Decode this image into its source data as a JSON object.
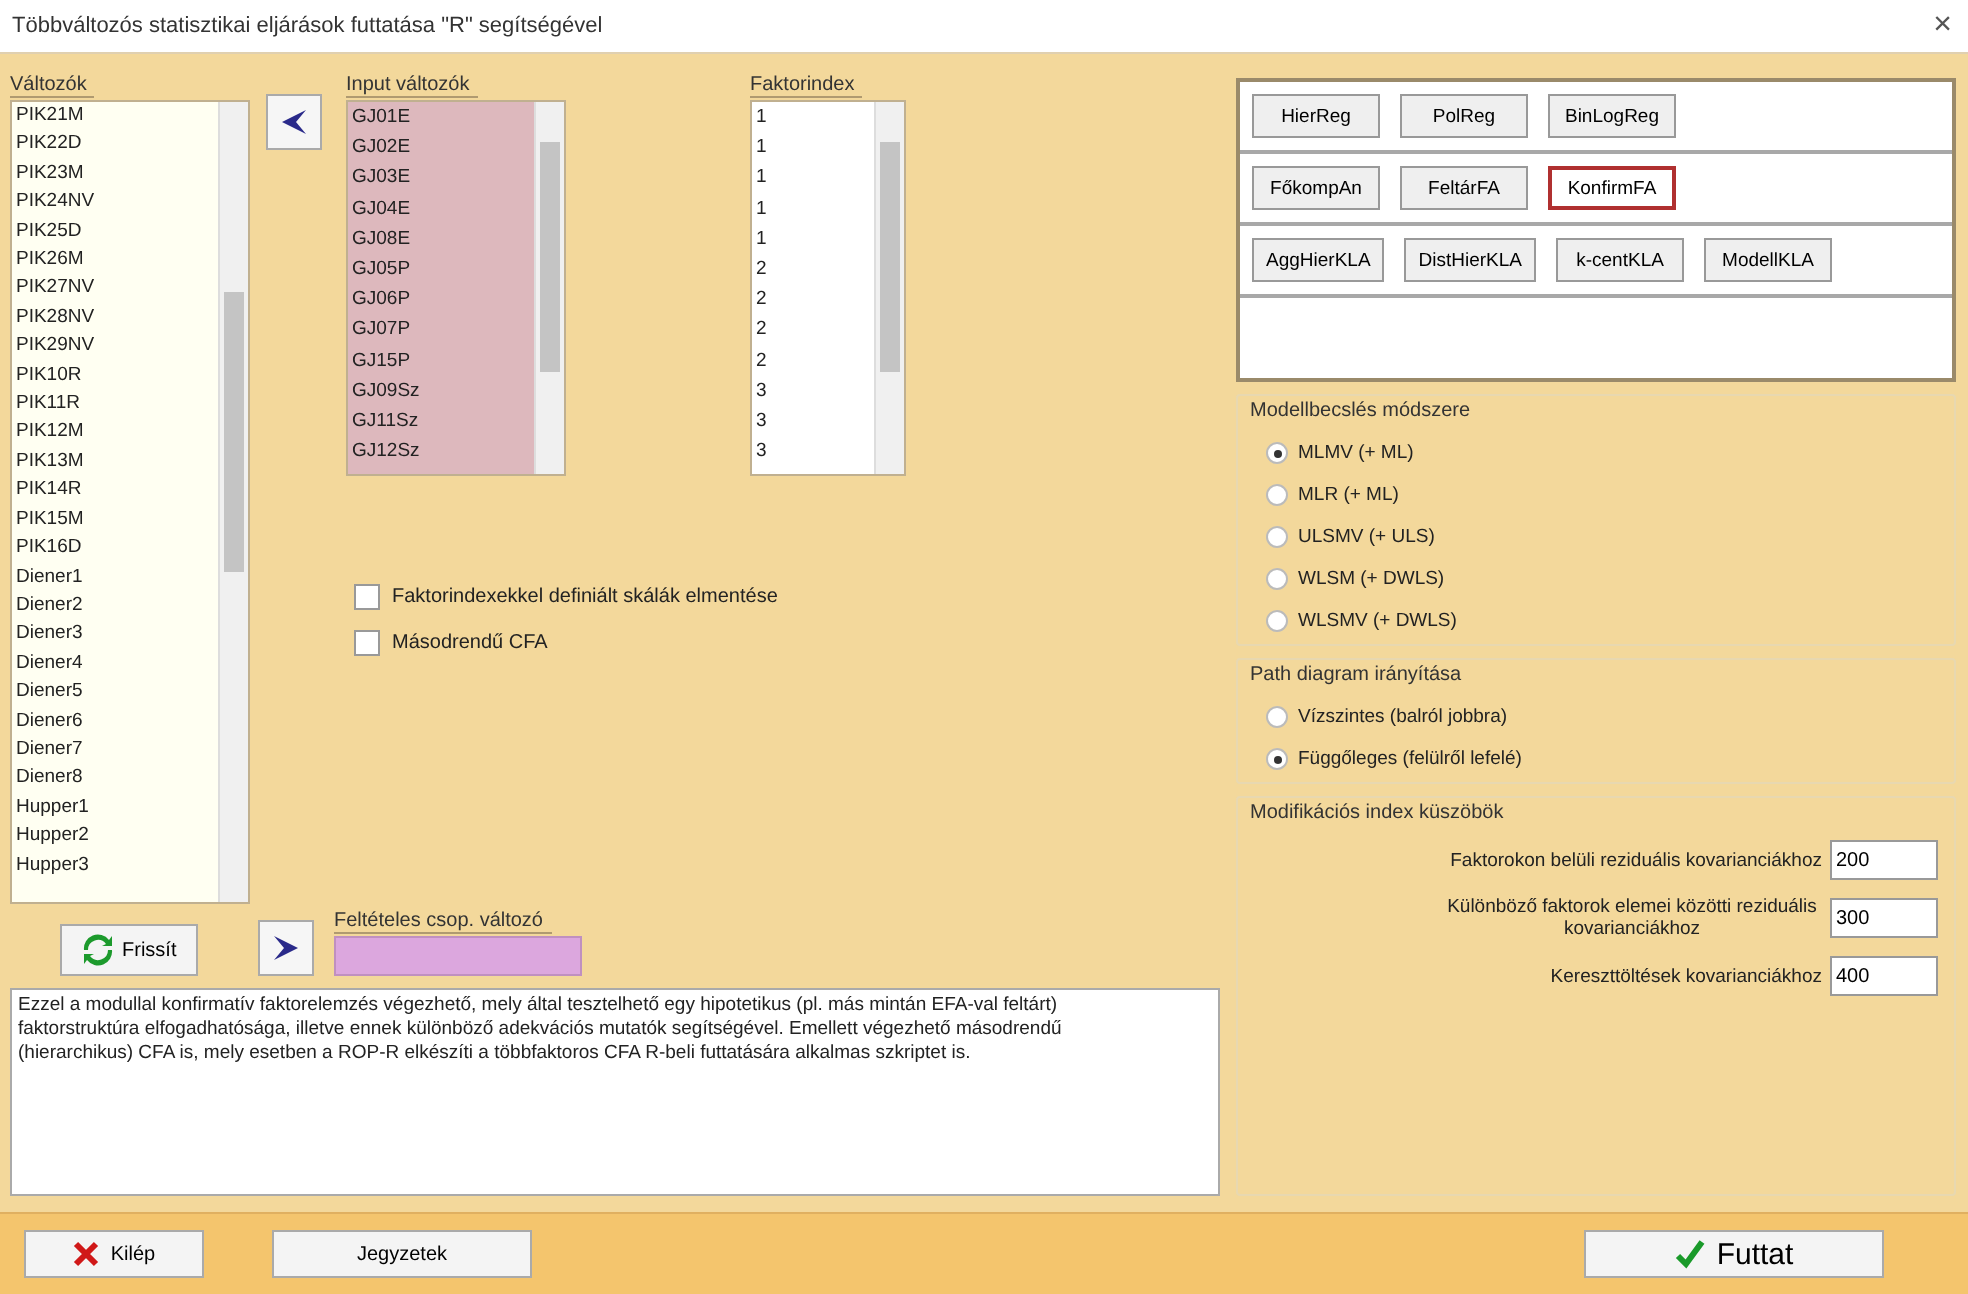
{
  "window": {
    "title": "Többváltozós statisztikai eljárások futtatása \"R\" segítségével",
    "close": "×"
  },
  "variables": {
    "label": "Változók",
    "items": [
      "PIK21M",
      "PIK22D",
      "PIK23M",
      "PIK24NV",
      "PIK25D",
      "PIK26M",
      "PIK27NV",
      "PIK28NV",
      "PIK29NV",
      "PIK10R",
      "PIK11R",
      "PIK12M",
      "PIK13M",
      "PIK14R",
      "PIK15M",
      "PIK16D",
      "Diener1",
      "Diener2",
      "Diener3",
      "Diener4",
      "Diener5",
      "Diener6",
      "Diener7",
      "Diener8",
      "Hupper1",
      "Hupper2",
      "Hupper3"
    ]
  },
  "input_variables": {
    "label": "Input változók",
    "items": [
      "GJ01E",
      "GJ02E",
      "GJ03E",
      "GJ04E",
      "GJ08E",
      "GJ05P",
      "GJ06P",
      "GJ07P",
      "GJ15P",
      "GJ09Sz",
      "GJ11Sz",
      "GJ12Sz"
    ]
  },
  "factor_index": {
    "label": "Faktorindex",
    "items": [
      "1",
      "1",
      "1",
      "1",
      "1",
      "2",
      "2",
      "2",
      "2",
      "3",
      "3",
      "3"
    ]
  },
  "checkboxes": [
    {
      "label": "Faktorindexekkel definiált skálák elmentése",
      "checked": false
    },
    {
      "label": "Másodrendű CFA",
      "checked": false
    }
  ],
  "refresh_button": "Frissít",
  "group_variable": {
    "label": "Feltételes csop. változó"
  },
  "description": "Ezzel a modullal konfirmatív faktorelemzés végezhető, mely által tesztelhető egy hipotetikus (pl. más mintán EFA-val feltárt) faktorstruktúra elfogadhatósága, illetve ennek különböző adekvációs mutatók segítségével. Emellett végezhető másodrendű (hierarchikus) CFA is, mely esetben a ROP-R elkészíti a többfaktoros CFA R-beli futtatására alkalmas szkriptet is.",
  "module_rows": [
    [
      {
        "label": "HierReg",
        "selected": false
      },
      {
        "label": "PolReg",
        "selected": false
      },
      {
        "label": "BinLogReg",
        "selected": false
      }
    ],
    [
      {
        "label": "FőkompAn",
        "selected": false
      },
      {
        "label": "FeltárFA",
        "selected": false
      },
      {
        "label": "KonfirmFA",
        "selected": true
      }
    ],
    [
      {
        "label": "AggHierKLA",
        "selected": false
      },
      {
        "label": "DistHierKLA",
        "selected": false
      },
      {
        "label": "k-centKLA",
        "selected": false
      },
      {
        "label": "ModellKLA",
        "selected": false
      }
    ]
  ],
  "estimation": {
    "title": "Modellbecslés módszere",
    "options": [
      {
        "label": "MLMV (+ ML)",
        "selected": true
      },
      {
        "label": "MLR (+ ML)",
        "selected": false
      },
      {
        "label": "ULSMV (+ ULS)",
        "selected": false
      },
      {
        "label": "WLSM (+ DWLS)",
        "selected": false
      },
      {
        "label": "WLSMV (+ DWLS)",
        "selected": false
      }
    ]
  },
  "path_diagram": {
    "title": "Path diagram irányítása",
    "options": [
      {
        "label": "Vízszintes (balról jobbra)",
        "selected": false
      },
      {
        "label": "Függőleges (felülről lefelé)",
        "selected": true
      }
    ]
  },
  "mod_index": {
    "title": "Modifikációs index küszöbök",
    "fields": [
      {
        "label": "Faktorokon belüli reziduális kovarianciákhoz",
        "value": "200"
      },
      {
        "label": "Különböző faktorok elemei közötti reziduális kovarianciákhoz",
        "value": "300"
      },
      {
        "label": "Kereszttöltések kovarianciákhoz",
        "value": "400"
      }
    ]
  },
  "footer": {
    "exit": "Kilép",
    "notes": "Jegyzetek",
    "run": "Futtat"
  }
}
